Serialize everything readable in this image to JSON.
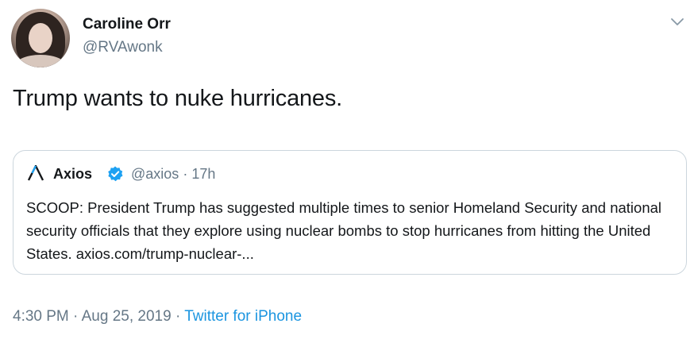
{
  "author": {
    "name": "Caroline Orr",
    "handle": "@RVAwonk"
  },
  "tweet": {
    "text": "Trump wants to nuke hurricanes."
  },
  "quoted": {
    "name": "Axios",
    "handle": "@axios",
    "separator": "·",
    "time": "17h",
    "text": "SCOOP: President Trump has suggested multiple times to senior Homeland Security and national security officials that they explore using nuclear bombs to stop hurricanes from hitting the United States. axios.com/trump-nuclear-..."
  },
  "footer": {
    "time": "4:30 PM",
    "sep1": "·",
    "date": "Aug 25, 2019",
    "sep2": "·",
    "source": "Twitter for iPhone"
  },
  "icons": {
    "menu": "chevron-down-icon",
    "verified": "verified-badge-icon",
    "brand": "axios-logo-icon"
  },
  "colors": {
    "link": "#1b95e0",
    "secondary": "#657786",
    "border": "#ccd6dd",
    "verified": "#1da1f2"
  }
}
